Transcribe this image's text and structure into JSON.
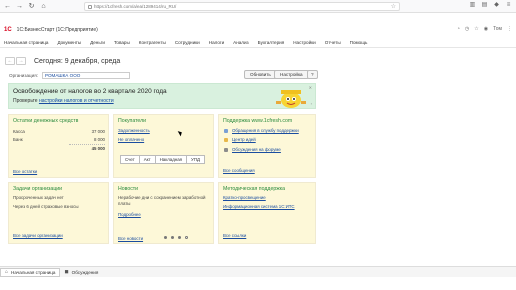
{
  "browser": {
    "url": "https://1cfresh.com/a/ea/1289414/ru_RU/"
  },
  "app": {
    "logo": "1С",
    "title": "1С:БизнесСтарт  (1С:Предприятие)",
    "user": "Том"
  },
  "menu": [
    "Начальная страница",
    "Документы",
    "Деньги",
    "Товары",
    "Контрагенты",
    "Сотрудники",
    "Налоги",
    "Анализ",
    "Бухгалтерия",
    "Настройки",
    "Отчеты",
    "Помощь"
  ],
  "header": {
    "title": "Сегодня: 9 декабря, среда",
    "org_label": "Организация:",
    "org_value": "РОМАШКА ООО",
    "refresh_btn": "Обновить",
    "settings_btn": "Настройка",
    "help_btn": "?"
  },
  "banner": {
    "title": "Освобождение от налогов во 2 квартале 2020 года",
    "sub_prefix": "Проверьте ",
    "sub_link": "настройки налогов и отчетности"
  },
  "panels": {
    "cash": {
      "title": "Остатки денежных средств",
      "rows": [
        {
          "label": "Касса",
          "value": "37 000"
        },
        {
          "label": "Банк",
          "value": "8 000"
        }
      ],
      "total": "45 000",
      "link": "Все остатки"
    },
    "buyers": {
      "title": "Покупатели",
      "links": [
        "Задолженность",
        "Не оплачено"
      ],
      "tabs": [
        "Счет",
        "Акт",
        "Накладная",
        "УПД"
      ]
    },
    "support": {
      "title": "Поддержка www.1cfresh.com",
      "links": [
        "Обращения в службу поддержки",
        "Центр идей",
        "Обсуждения на форуме"
      ],
      "all": "Все сообщения"
    },
    "tasks": {
      "title": "Задачи организации",
      "lines": [
        "Просроченных задач нет",
        "Через 6 дней страховые взносы"
      ],
      "link": "Все задачи организации"
    },
    "news": {
      "title": "Новости",
      "text1": "Нерабочие дни с сохранением заработной",
      "text2": "платы",
      "more": "Подробнее",
      "all": "Все новости"
    },
    "method": {
      "title": "Методическая поддержка",
      "links": [
        "Кратко-просвещение",
        "Информационная система 1С:ИТС"
      ],
      "all": "Все ссылки"
    }
  },
  "bottom": {
    "tab1": "Начальная страница",
    "tab2": "Обсуждения"
  }
}
